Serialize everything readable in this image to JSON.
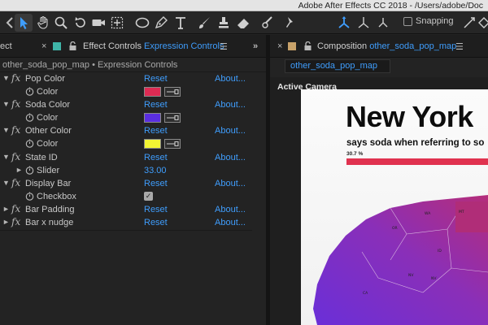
{
  "window": {
    "title": "Adobe After Effects CC 2018 - /Users/adobe/Doc"
  },
  "toolbar": {
    "snapping_label": "Snapping"
  },
  "left_panel": {
    "tabs": {
      "project_partial": "ect",
      "effect_controls_prefix": "Effect Controls",
      "effect_controls_layer": "Expression Controls"
    },
    "header": "other_soda_pop_map • Expression Controls",
    "reset_label": "Reset",
    "about_label": "About...",
    "effects": [
      {
        "name": "Pop Color",
        "param_label": "Color",
        "color": "#dd2b53"
      },
      {
        "name": "Soda Color",
        "param_label": "Color",
        "color": "#5a2ee0"
      },
      {
        "name": "Other Color",
        "param_label": "Color",
        "color": "#f2f533"
      },
      {
        "name": "State ID",
        "param_label": "Slider",
        "value": "33.00"
      },
      {
        "name": "Display Bar",
        "param_label": "Checkbox",
        "checked": true
      },
      {
        "name": "Bar Padding"
      },
      {
        "name": "Bar x nudge"
      }
    ]
  },
  "right_panel": {
    "tab_prefix": "Composition",
    "tab_name": "other_soda_pop_map",
    "sub_tab": "other_soda_pop_map",
    "viewer_label": "Active Camera",
    "canvas": {
      "headline": "New York",
      "subline": "says soda when referring to so",
      "percent": "30.7 %",
      "bar_color": "#e0324f"
    }
  }
}
